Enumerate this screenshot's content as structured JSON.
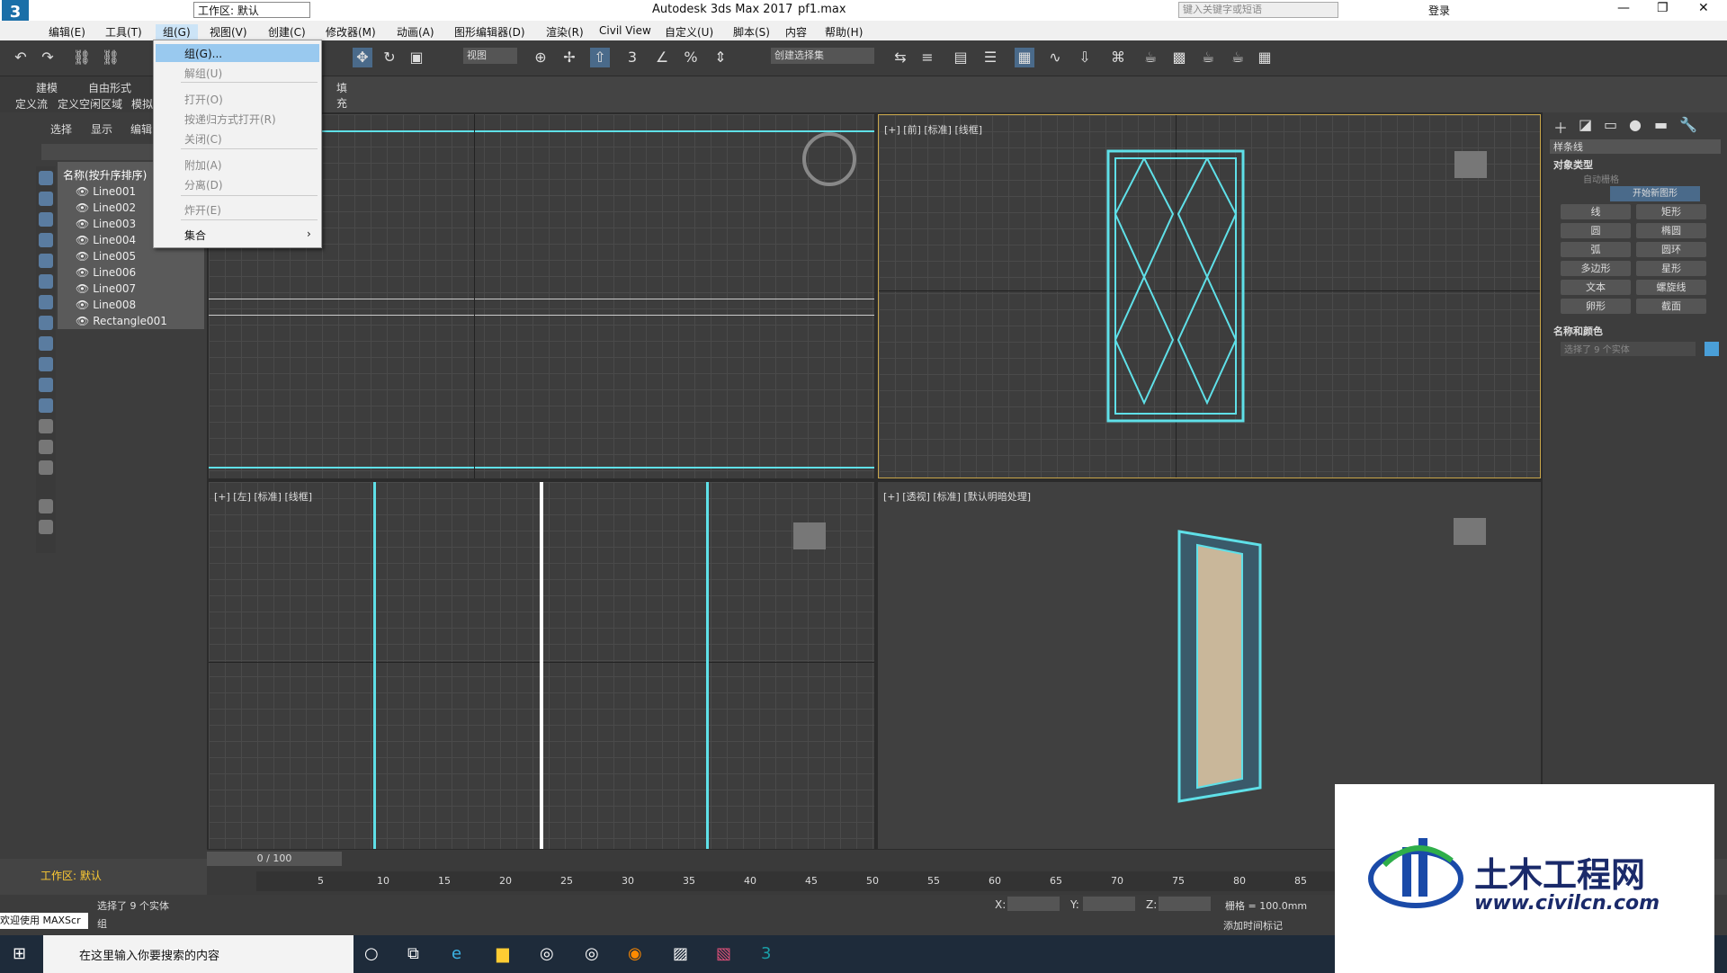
{
  "window": {
    "title": "Autodesk 3ds Max 2017",
    "file": "pf1.max",
    "workspace": "工作区: 默认",
    "search_placeholder": "键入关键字或短语",
    "login": "登录"
  },
  "menus": [
    "编辑(E)",
    "工具(T)",
    "组(G)",
    "视图(V)",
    "创建(C)",
    "修改器(M)",
    "动画(A)",
    "图形编辑器(D)",
    "渲染(R)",
    "Civil View",
    "自定义(U)",
    "脚本(S)",
    "内容",
    "帮助(H)"
  ],
  "toolbar": {
    "view_dropdown": "视图",
    "selection_set": "创建选择集"
  },
  "ribbon": {
    "tabs": [
      "建模",
      "自由形式"
    ],
    "sub": [
      "定义流",
      "定义空闲区域",
      "模拟"
    ],
    "fill_tab": "填充"
  },
  "scene": {
    "tabs": [
      "选择",
      "显示",
      "编辑"
    ],
    "header": "名称(按升序排序)",
    "items": [
      "Line001",
      "Line002",
      "Line003",
      "Line004",
      "Line005",
      "Line006",
      "Line007",
      "Line008",
      "Rectangle001"
    ]
  },
  "group_menu": {
    "items": [
      "组(G)...",
      "解组(U)",
      "打开(O)",
      "按递归方式打开(R)",
      "关闭(C)",
      "附加(A)",
      "分离(D)",
      "炸开(E)",
      "集合"
    ]
  },
  "viewports": {
    "top_right": "[+] [前] [标准] [线框]",
    "bottom_left": "[+] [左] [标准] [线框]",
    "bottom_right": "[+] [透视] [标准] [默认明暗处理]"
  },
  "command_panel": {
    "dropdown": "样条线",
    "rollout1": "对象类型",
    "auto_grid": "自动栅格",
    "start_new_shape": "开始新图形",
    "buttons": [
      "线",
      "矩形",
      "圆",
      "椭圆",
      "弧",
      "圆环",
      "多边形",
      "星形",
      "文本",
      "螺旋线",
      "卵形",
      "截面"
    ],
    "rollout2": "名称和颜色",
    "selected_text": "选择了 9 个实体"
  },
  "timeline": {
    "frame": "0 / 100",
    "ticks": [
      "5",
      "10",
      "15",
      "20",
      "25",
      "30",
      "35",
      "40",
      "45",
      "50",
      "55",
      "60",
      "65",
      "70",
      "75",
      "80",
      "85"
    ]
  },
  "status": {
    "workspace": "工作区: 默认",
    "welcome": "欢迎使用 MAXScr",
    "selected": "选择了 9 个实体",
    "group_label": "组",
    "x_label": "X:",
    "y_label": "Y:",
    "z_label": "Z:",
    "grid": "栅格 = 100.0mm",
    "add_time_tag": "添加时间标记"
  },
  "taskbar": {
    "search": "在这里输入你要搜索的内容"
  },
  "watermark": {
    "brand": "土木工程网",
    "url": "www.civilcn.com"
  },
  "colors": {
    "selection": "#5fe0e8",
    "accent": "#4a9fd8",
    "menu_highlight": "#99c9ef"
  }
}
